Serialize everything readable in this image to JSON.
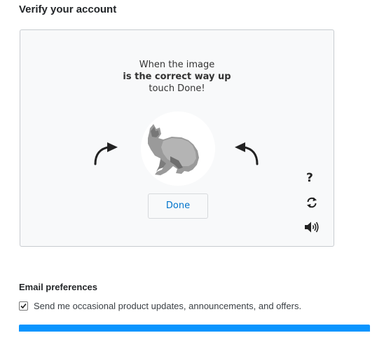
{
  "page": {
    "heading": "Verify your account"
  },
  "captcha": {
    "instruction_line1": "When the image",
    "instruction_line2": "is the correct way up",
    "instruction_line3": "touch Done!",
    "done_label": "Done",
    "help_label": "?",
    "icons": {
      "rotate_left": "curved-arrow-left-icon",
      "rotate_right": "curved-arrow-right-icon",
      "help": "question-mark-icon",
      "reload": "reload-icon",
      "audio": "speaker-icon"
    }
  },
  "email_preferences": {
    "heading": "Email preferences",
    "checkbox_label": "Send me occasional product updates, announcements, and offers.",
    "checked": true
  },
  "colors": {
    "primary_blue": "#0a95ff",
    "link_blue": "#0074cc"
  }
}
